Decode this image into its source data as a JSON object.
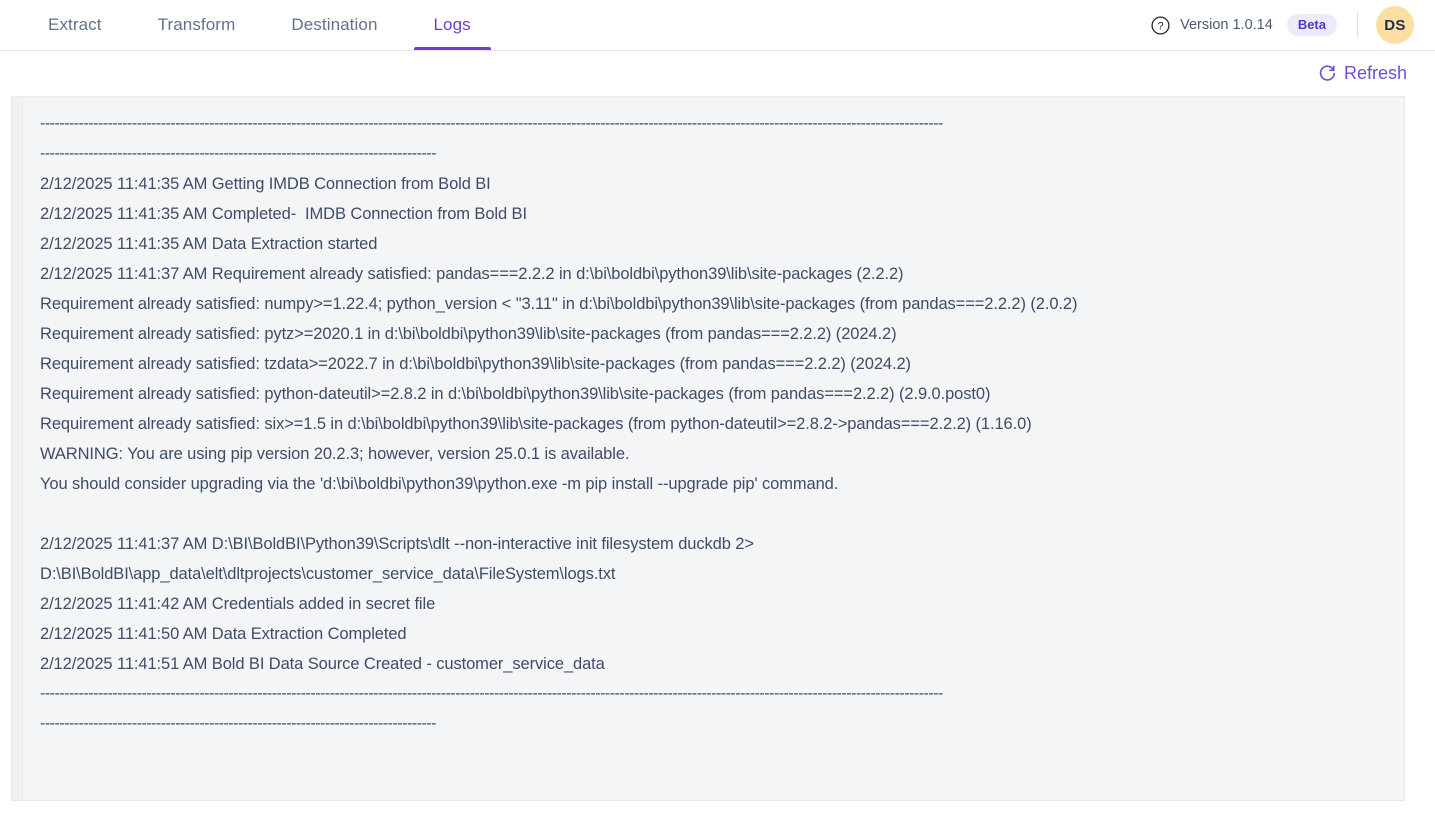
{
  "header": {
    "tabs": [
      {
        "label": "Extract",
        "active": false
      },
      {
        "label": "Transform",
        "active": false
      },
      {
        "label": "Destination",
        "active": false
      },
      {
        "label": "Logs",
        "active": true
      }
    ],
    "help_icon": "question-circle-icon",
    "version_text": "Version 1.0.14",
    "beta_label": "Beta",
    "avatar_initials": "DS",
    "accent_color": "#6d3fd6",
    "beta_bg_color": "#eeeafb",
    "beta_text_color": "#4b3ccc",
    "avatar_bg_color": "#fbdfa2"
  },
  "toolbar": {
    "refresh_label": "Refresh",
    "refresh_icon": "refresh-icon",
    "refresh_color": "#6d4fd6"
  },
  "log_panel": {
    "background_color": "#f4f5f7",
    "text_color": "#3e4d66",
    "lines": [
      "-------------------------------------------------------------------------------------------------------------------------------------------------------------------------------------------",
      "----------------------------------------------------------------------------------",
      "2/12/2025 11:41:35 AM Getting IMDB Connection from Bold BI",
      "2/12/2025 11:41:35 AM Completed-  IMDB Connection from Bold BI",
      "2/12/2025 11:41:35 AM Data Extraction started",
      "2/12/2025 11:41:37 AM Requirement already satisfied: pandas===2.2.2 in d:\\bi\\boldbi\\python39\\lib\\site-packages (2.2.2)",
      "Requirement already satisfied: numpy>=1.22.4; python_version < \"3.11\" in d:\\bi\\boldbi\\python39\\lib\\site-packages (from pandas===2.2.2) (2.0.2)",
      "Requirement already satisfied: pytz>=2020.1 in d:\\bi\\boldbi\\python39\\lib\\site-packages (from pandas===2.2.2) (2024.2)",
      "Requirement already satisfied: tzdata>=2022.7 in d:\\bi\\boldbi\\python39\\lib\\site-packages (from pandas===2.2.2) (2024.2)",
      "Requirement already satisfied: python-dateutil>=2.8.2 in d:\\bi\\boldbi\\python39\\lib\\site-packages (from pandas===2.2.2) (2.9.0.post0)",
      "Requirement already satisfied: six>=1.5 in d:\\bi\\boldbi\\python39\\lib\\site-packages (from python-dateutil>=2.8.2->pandas===2.2.2) (1.16.0)",
      "WARNING: You are using pip version 20.2.3; however, version 25.0.1 is available.",
      "You should consider upgrading via the 'd:\\bi\\boldbi\\python39\\python.exe -m pip install --upgrade pip' command.",
      "",
      "2/12/2025 11:41:37 AM D:\\BI\\BoldBI\\Python39\\Scripts\\dlt --non-interactive init filesystem duckdb 2>",
      "D:\\BI\\BoldBI\\app_data\\elt\\dltprojects\\customer_service_data\\FileSystem\\logs.txt",
      "2/12/2025 11:41:42 AM Credentials added in secret file",
      "2/12/2025 11:41:50 AM Data Extraction Completed",
      "2/12/2025 11:41:51 AM Bold BI Data Source Created - customer_service_data",
      "-------------------------------------------------------------------------------------------------------------------------------------------------------------------------------------------",
      "----------------------------------------------------------------------------------"
    ]
  }
}
